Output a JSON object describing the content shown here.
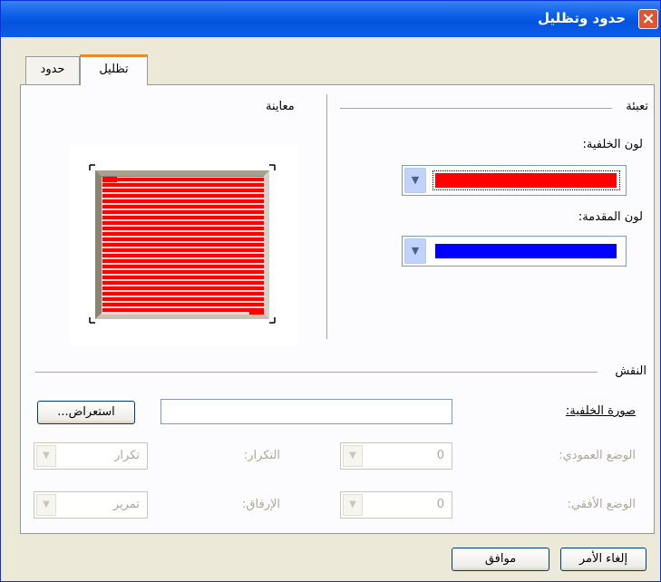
{
  "window": {
    "title": "حدود وتظليل",
    "close_icon": "close-icon"
  },
  "tabs": [
    {
      "label": "تظليل",
      "active": true
    },
    {
      "label": "حدود",
      "active": false
    }
  ],
  "fill": {
    "section_label": "تعبئة",
    "background_color_label": "لون الخلفية:",
    "background_color": "#ff0000",
    "foreground_color_label": "لون المقدمة:",
    "foreground_color": "#0000ff"
  },
  "preview": {
    "label": "معاينة",
    "stripe_color": "#ff0000"
  },
  "pattern": {
    "section_label": "النقش",
    "background_image_label": "صورة الخلفية:",
    "background_image_value": "",
    "browse_button": "استعراض...",
    "vertical_position_label": "الوضع العمودي:",
    "vertical_position_value": "0",
    "repeat_label": "التكرار:",
    "repeat_value": "تكرار",
    "horizontal_position_label": "الوضع الأفقي:",
    "horizontal_position_value": "0",
    "attachment_label": "الإرفاق:",
    "attachment_value": "تمرير"
  },
  "buttons": {
    "ok": "موافق",
    "cancel": "إلغاء الأمر"
  }
}
